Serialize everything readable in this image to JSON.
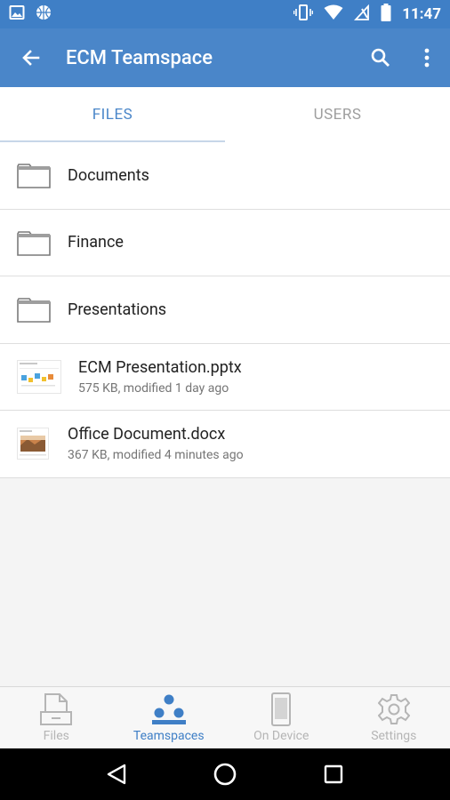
{
  "status_bar": {
    "time": "11:47",
    "left_icons": [
      "image-icon",
      "basketball-icon"
    ],
    "right_icons": [
      "vibrate-icon",
      "wifi-icon",
      "no-signal-icon",
      "battery-icon"
    ]
  },
  "app_bar": {
    "title": "ECM Teamspace",
    "icons": [
      "back-arrow-icon",
      "search-icon",
      "more-vert-icon"
    ]
  },
  "tabs": [
    {
      "label": "FILES",
      "active": true
    },
    {
      "label": "USERS",
      "active": false
    }
  ],
  "files": [
    {
      "type": "folder",
      "name": "Documents"
    },
    {
      "type": "folder",
      "name": "Finance"
    },
    {
      "type": "folder",
      "name": "Presentations"
    },
    {
      "type": "pptx",
      "name": "ECM Presentation.pptx",
      "meta": "575 KB, modified 1 day ago"
    },
    {
      "type": "docx",
      "name": "Office Document.docx",
      "meta": "367 KB, modified 4 minutes ago"
    }
  ],
  "bottom_nav": [
    {
      "label": "Files",
      "icon": "files-icon",
      "active": false
    },
    {
      "label": "Teamspaces",
      "icon": "teamspaces-icon",
      "active": true
    },
    {
      "label": "On Device",
      "icon": "device-icon",
      "active": false
    },
    {
      "label": "Settings",
      "icon": "settings-icon",
      "active": false
    }
  ],
  "colors": {
    "primary": "#4a86c9",
    "status_bar": "#3f7fc6",
    "inactive": "#b5b5b5"
  }
}
